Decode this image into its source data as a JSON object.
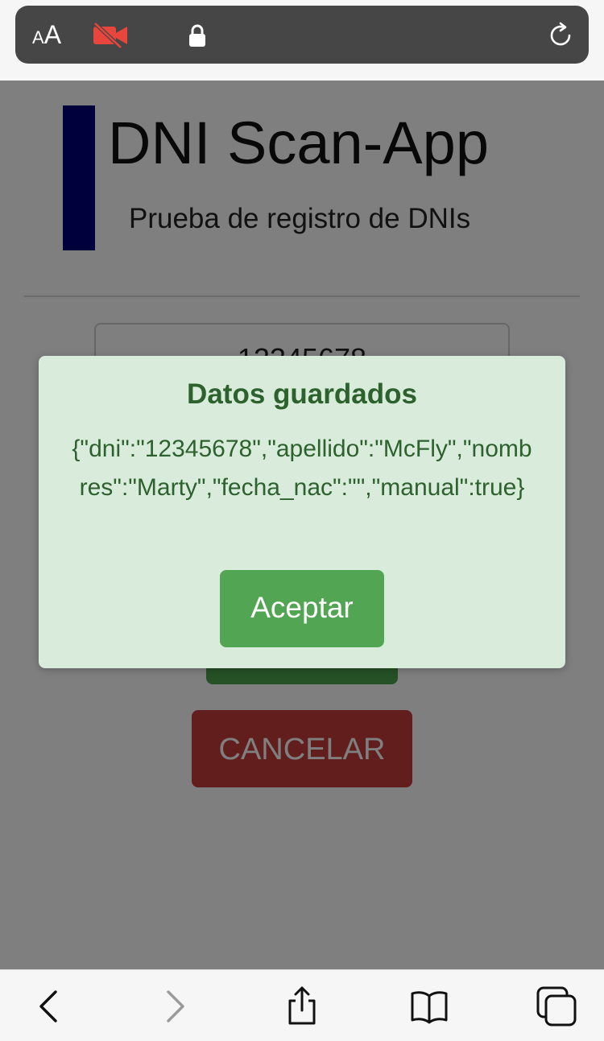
{
  "browser": {
    "text_size_small": "A",
    "text_size_big": "A",
    "icons": {
      "text_size": "text-size-icon",
      "camera_off": "camera-off-icon",
      "lock": "lock-icon",
      "reload": "reload-icon"
    }
  },
  "app": {
    "title": "DNI Scan-App",
    "subtitle": "Prueba de registro de DNIs",
    "brand_color": "#00007a"
  },
  "form": {
    "dni_value": "12345678",
    "save_label": "",
    "cancel_label": "CANCELAR"
  },
  "modal": {
    "title": "Datos guardados",
    "body": "{\"dni\":\"12345678\",\"apellido\":\"McFly\",\"nombres\":\"Marty\",\"fecha_nac\":\"\",\"manual\":true}",
    "accept_label": "Aceptar"
  },
  "toolbar": {
    "icons": [
      "back-icon",
      "forward-icon",
      "share-icon",
      "bookmarks-icon",
      "tabs-icon"
    ]
  },
  "colors": {
    "accent_green": "#52a552",
    "danger_red": "#c43a3a",
    "modal_bg": "#d9ecdb",
    "modal_text": "#2d612d"
  }
}
